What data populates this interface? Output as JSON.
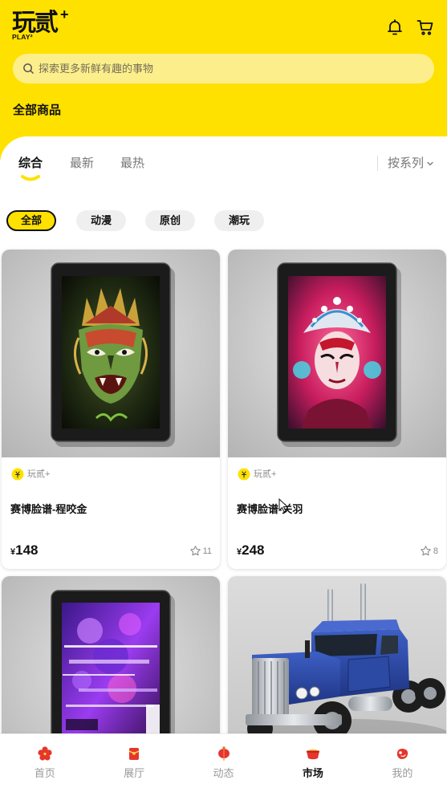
{
  "colors": {
    "brand_yellow": "#FFE100",
    "search_bg": "#FDEE8C",
    "chip_bg": "#EFEFEF",
    "nav_icon_red": "#E5362C",
    "text_primary": "#111111",
    "text_secondary": "#8A8A8A"
  },
  "header": {
    "logo": {
      "mark": "玩贰",
      "plus": "+",
      "sub": "PLAY²"
    },
    "actions": [
      {
        "icon": "bell-icon"
      },
      {
        "icon": "cart-icon"
      }
    ],
    "search": {
      "icon": "search-icon",
      "placeholder": "探索更多新鲜有趣的事物",
      "value": ""
    },
    "section_title": "全部商品"
  },
  "sort_tabs": [
    {
      "label": "综合",
      "active": true
    },
    {
      "label": "最新",
      "active": false
    },
    {
      "label": "最热",
      "active": false
    }
  ],
  "series_filter": {
    "label": "按系列",
    "icon": "chevron-down-icon"
  },
  "category_chips": [
    {
      "label": "全部",
      "active": true
    },
    {
      "label": "动漫",
      "active": false
    },
    {
      "label": "原创",
      "active": false
    },
    {
      "label": "潮玩",
      "active": false
    }
  ],
  "products": [
    {
      "brand": "玩贰+",
      "title": "赛博脸谱-程咬金",
      "currency": "¥",
      "price": "148",
      "likes": "11"
    },
    {
      "brand": "玩贰+",
      "title": "赛博脸谱-关羽",
      "currency": "¥",
      "price": "248",
      "likes": "8"
    }
  ],
  "bottom_nav": [
    {
      "label": "首页",
      "icon": "home-icon",
      "active": false
    },
    {
      "label": "展厅",
      "icon": "gallery-icon",
      "active": false
    },
    {
      "label": "动态",
      "icon": "feed-icon",
      "active": false
    },
    {
      "label": "市场",
      "icon": "market-icon",
      "active": true
    },
    {
      "label": "我的",
      "icon": "profile-icon",
      "active": false
    }
  ]
}
